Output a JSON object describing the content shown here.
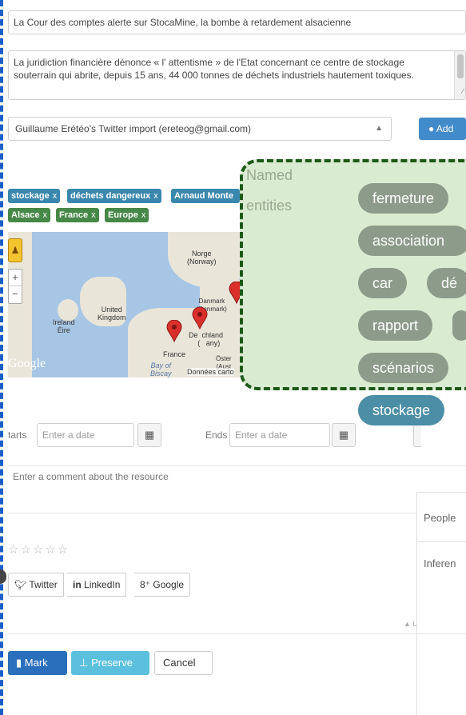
{
  "form": {
    "title_value": "La Cour des comptes alerte sur StocaMine, la bombe à retardement alsacienne",
    "description_value": "La juridiction financière dénonce « l' attentisme » de l'Etat concernant ce centre de stockage souterrain qui abrite, depuis 15 ans, 44 000 tonnes de déchets industriels hautement toxiques.",
    "account_select": "Guillaume Erétéo's Twitter import (ereteog@gmail.com)",
    "add_label": "Add",
    "tag_remove": "x",
    "tags_blue": [
      "stockage",
      "déchets dangereux",
      "Arnaud Monte"
    ],
    "tags_green": [
      "Alsace",
      "France",
      "Europe"
    ]
  },
  "map": {
    "labels": {
      "norge": "Norge\n(Norway)",
      "danmark": "Danmark\n(Denmark)",
      "uk": "United\nKingdom",
      "ireland": "Ireland\nÉire",
      "deutschland": "De  chland\n   (   any)",
      "osterreich": "Öster\n(Aust",
      "france": "France",
      "biscay": "Bay of\nBiscay"
    },
    "google": "Google",
    "credit": "Données carto",
    "zoom_in": "+",
    "zoom_out": "−"
  },
  "dates": {
    "starts_label": "tarts",
    "ends_label": "Ends",
    "placeholder": "Enter a date"
  },
  "comment_placeholder": "Enter a comment about the resource",
  "rating_stars": "☆☆☆☆☆",
  "share": {
    "twitter": "Twitter",
    "linkedin_prefix": "in",
    "linkedin": "LinkedIn",
    "google_prefix": "8⁺",
    "google": "Google"
  },
  "scroll_hint": "▲ L",
  "actions": {
    "mark": "Mark",
    "preserve": "Preserve",
    "cancel": "Cancel"
  },
  "right_panel": {
    "people": "People",
    "inference": "Inferen"
  },
  "named_entities": {
    "title_line1": "Named",
    "title_line2": "entities",
    "pills": [
      "fermeture",
      "association",
      "car",
      "dé",
      "rapport",
      "scénarios",
      "stockage"
    ]
  },
  "colors": {
    "primary": "#428bca",
    "info": "#5bc0de",
    "tag_blue": "#3a87ad",
    "tag_green": "#468847",
    "overlay_border": "#1d5a18",
    "pill": "#8d9b8a",
    "pill_active": "#4b8ea6"
  }
}
